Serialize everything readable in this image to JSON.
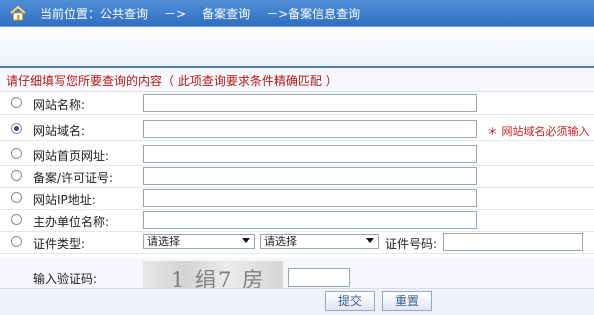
{
  "breadcrumb": {
    "prefix": "当前位置：",
    "items": [
      "公共查询",
      "备案查询",
      "备案信息查询"
    ],
    "separator": "－>"
  },
  "form": {
    "instruction": "请仔细填写您所要查询的内容（ 此项查询要求条件精确匹配 ）",
    "options": [
      {
        "label": "网站名称:",
        "value": "",
        "checked": false
      },
      {
        "label": "网站域名:",
        "value": "",
        "checked": true,
        "hint": "＊ 网站域名必须输入"
      },
      {
        "label": "网站首页网址:",
        "value": "",
        "checked": false
      },
      {
        "label": "备案/许可证号:",
        "value": "",
        "checked": false
      },
      {
        "label": "网站IP地址:",
        "value": "",
        "checked": false
      },
      {
        "label": "主办单位名称:",
        "value": "",
        "checked": false
      },
      {
        "label": "证件类型:",
        "checked": false
      }
    ],
    "select1": "请选择",
    "select2": "请选择",
    "cert_number_label": "证件号码:",
    "captcha_label": "输入验证码:",
    "captcha_text": "1 绢7 房",
    "submit": "提交",
    "reset": "重置"
  },
  "colors": {
    "topbar": "#2f6fc0",
    "hint": "#c81f1f",
    "instruction": "#b01818"
  }
}
